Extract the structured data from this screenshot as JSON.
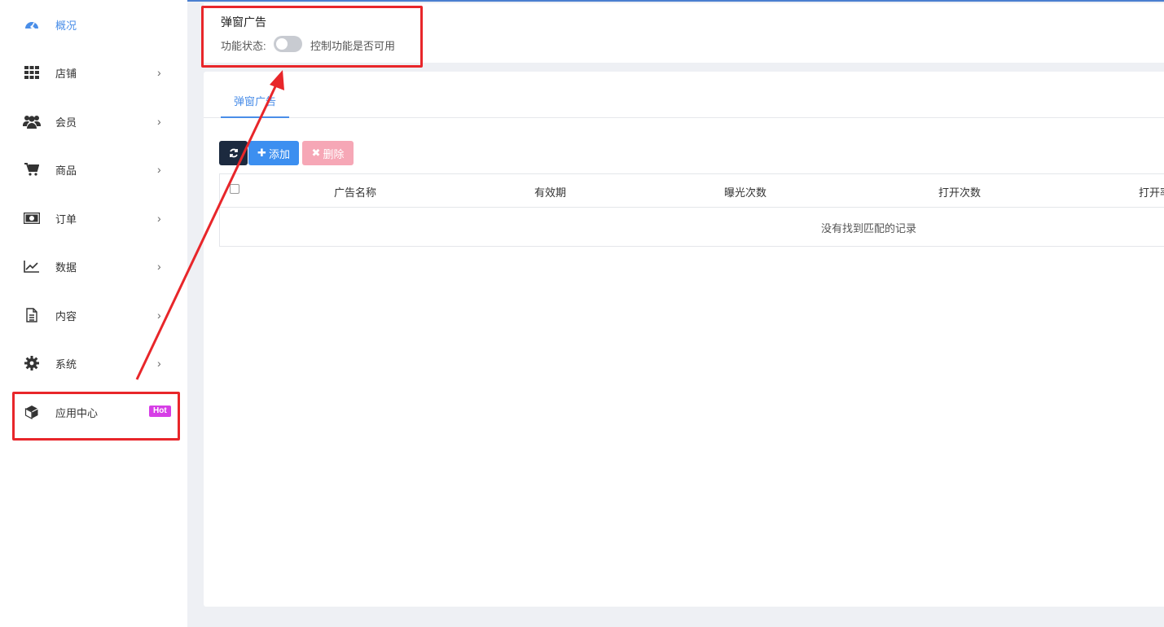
{
  "sidebar": {
    "items": [
      {
        "label": "概况",
        "icon": "dashboard-icon",
        "has_chevron": false,
        "active": true
      },
      {
        "label": "店铺",
        "icon": "grid-icon",
        "has_chevron": true
      },
      {
        "label": "会员",
        "icon": "users-icon",
        "has_chevron": true
      },
      {
        "label": "商品",
        "icon": "cart-icon",
        "has_chevron": true
      },
      {
        "label": "订单",
        "icon": "money-icon",
        "has_chevron": true
      },
      {
        "label": "数据",
        "icon": "line-chart-icon",
        "has_chevron": true
      },
      {
        "label": "内容",
        "icon": "document-icon",
        "has_chevron": true
      },
      {
        "label": "系统",
        "icon": "gear-icon",
        "has_chevron": true
      },
      {
        "label": "应用中心",
        "icon": "cube-icon",
        "has_chevron": false,
        "badge": "Hot"
      }
    ],
    "chevron": "›"
  },
  "header": {
    "title": "弹窗广告",
    "status_label": "功能状态:",
    "toggle_on": false,
    "toggle_desc": "控制功能是否可用"
  },
  "tabs": [
    {
      "label": "弹窗广告",
      "active": true
    }
  ],
  "toolbar": {
    "refresh_icon": "refresh-icon",
    "add_label": "添加",
    "delete_label": "删除"
  },
  "table": {
    "columns": [
      "广告名称",
      "有效期",
      "曝光次数",
      "打开次数",
      "打开率"
    ],
    "empty_text": "没有找到匹配的记录"
  },
  "colors": {
    "accent": "#4a8ee8",
    "badge": "#d63ee6",
    "annotation": "#e8262a"
  }
}
